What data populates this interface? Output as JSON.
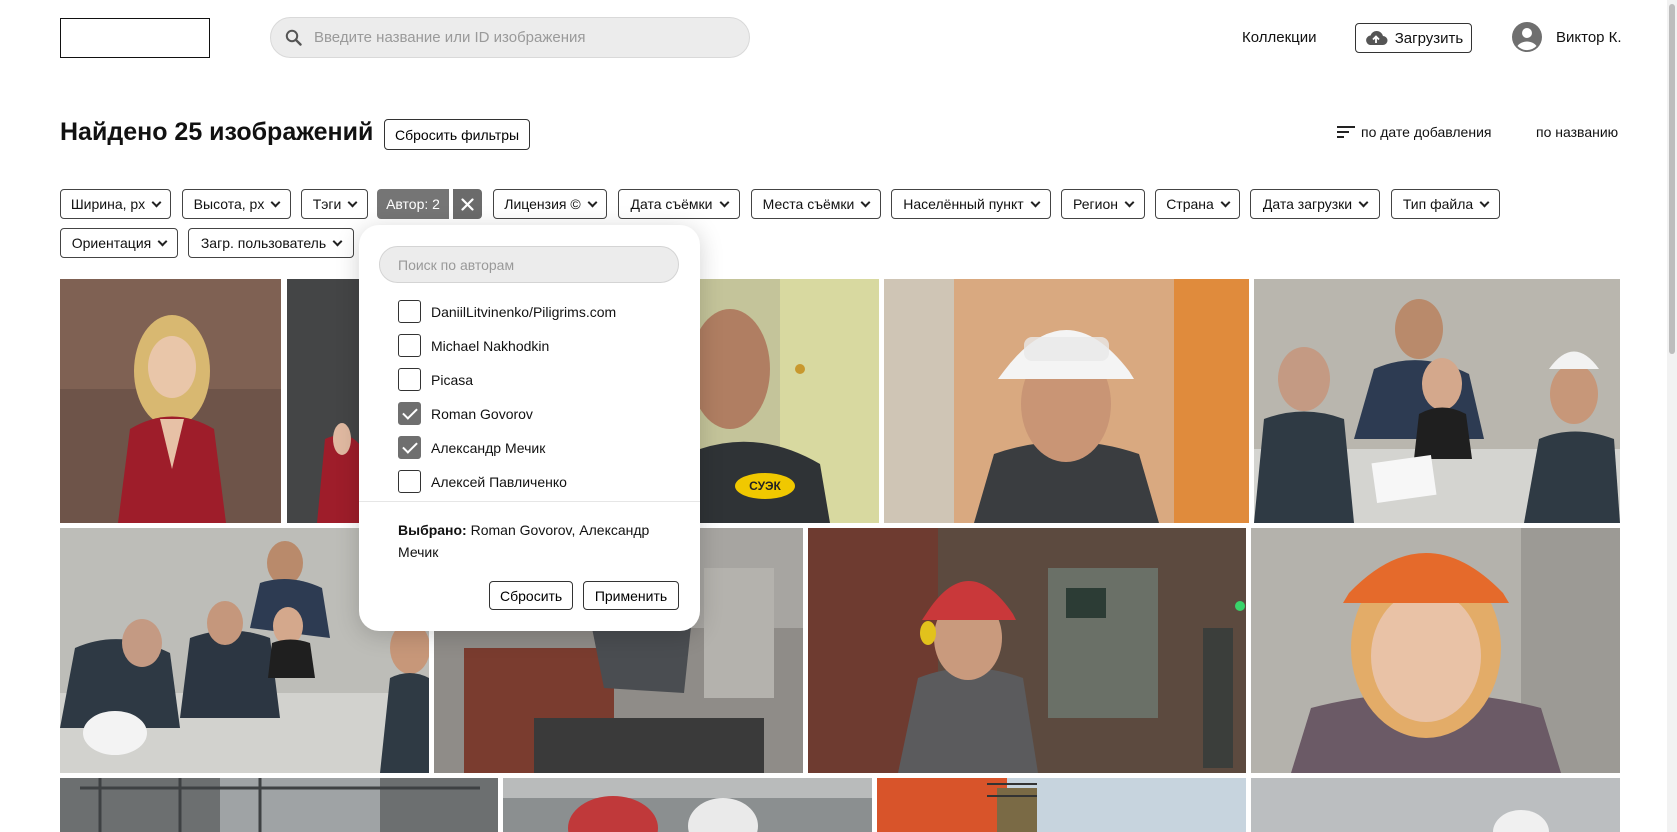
{
  "header": {
    "search_placeholder": "Введите название или ID изображения",
    "collections_label": "Коллекции",
    "upload_label": "Загрузить",
    "user_name": "Виктор К."
  },
  "results": {
    "title": "Найдено 25 изображений",
    "reset_filters_label": "Сбросить фильтры",
    "sort_by_date_label": "по дате добавления",
    "sort_by_name_label": "по названию"
  },
  "filters": {
    "width": "Ширина, px",
    "height": "Высота, px",
    "tags": "Тэги",
    "author_active": "Автор: 2",
    "license": "Лицензия ©",
    "shoot_date": "Дата съёмки",
    "shoot_places": "Места съёмки",
    "settlement": "Населённый пункт",
    "region": "Регион",
    "country": "Страна",
    "upload_date": "Дата загрузки",
    "file_type": "Тип файла",
    "orientation": "Ориентация",
    "uploaded_by": "Загр. пользователь"
  },
  "author_dropdown": {
    "search_placeholder": "Поиск по авторам",
    "authors": [
      {
        "name": "DaniilLitvinenko/Piligrims.com",
        "checked": false
      },
      {
        "name": "Michael Nakhodkin",
        "checked": false
      },
      {
        "name": "Picasa",
        "checked": false
      },
      {
        "name": "Roman Govorov",
        "checked": true
      },
      {
        "name": "Александр Мечик",
        "checked": true
      },
      {
        "name": "Алексей Павличенко",
        "checked": false
      }
    ],
    "selected_label": "Выбрано:",
    "selected_value": "Roman Govorov, Александр Мечик",
    "reset_label": "Сбросить",
    "apply_label": "Применить"
  },
  "colors": {
    "active_chip": "#757575",
    "checkbox_checked": "#6f6f6f",
    "search_bg": "#ececec"
  },
  "photo_logo_text": "СУЭК"
}
